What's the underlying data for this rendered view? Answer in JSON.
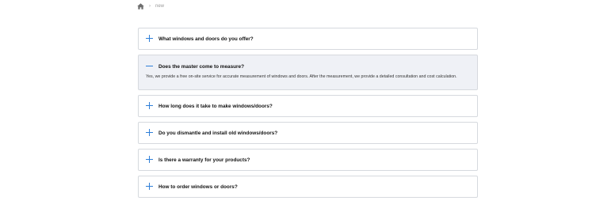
{
  "breadcrumb": {
    "home_icon": "home-icon",
    "separator": "›",
    "current": "new"
  },
  "faq": {
    "items": [
      {
        "question": "What windows and doors do you offer?",
        "expanded": false,
        "toggle_icon": "plus-icon"
      },
      {
        "question": "Does the master come to measure?",
        "expanded": true,
        "toggle_icon": "minus-icon",
        "answer": "Yes, we provide a free on-site service for accurate measurement of windows and doors. After the measurement, we provide a detailed consultation and cost calculation."
      },
      {
        "question": "How long does it take to make windows/doors?",
        "expanded": false,
        "toggle_icon": "plus-icon"
      },
      {
        "question": "Do you dismantle and install old windows/doors?",
        "expanded": false,
        "toggle_icon": "plus-icon"
      },
      {
        "question": "Is there a warranty for your products?",
        "expanded": false,
        "toggle_icon": "plus-icon"
      },
      {
        "question": "How to order windows or doors?",
        "expanded": false,
        "toggle_icon": "plus-icon"
      }
    ]
  },
  "colors": {
    "accent": "#2f7fd8",
    "expanded_background": "#eff1f6",
    "border": "#d6d9de"
  }
}
